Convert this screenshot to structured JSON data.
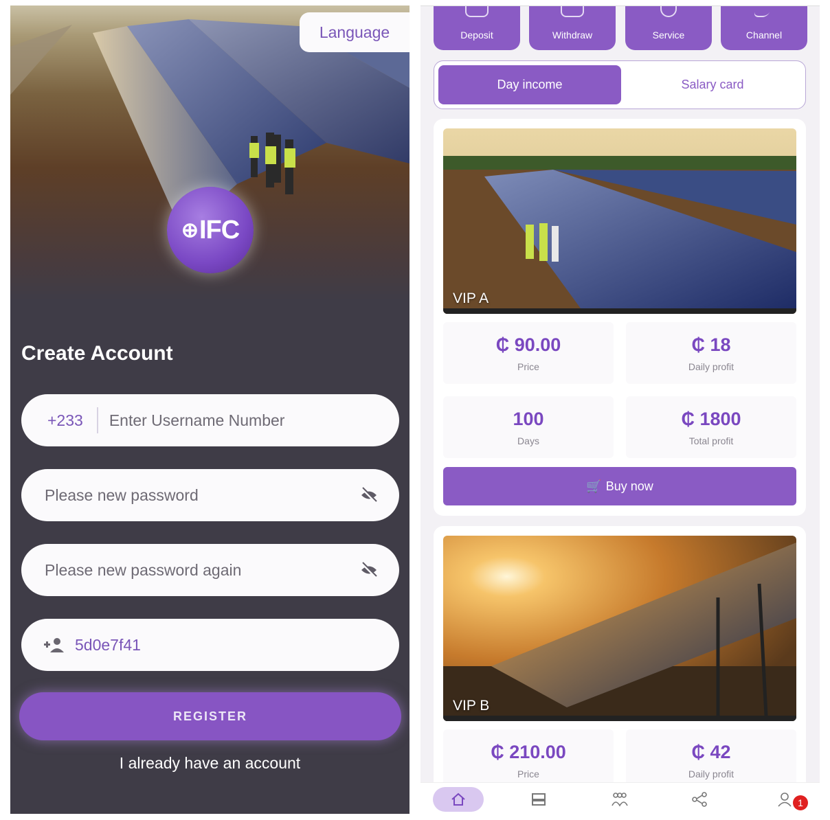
{
  "register": {
    "language_label": "Language",
    "logo_text": "IFC",
    "title": "Create Account",
    "country_code": "+233",
    "username_placeholder": "Enter Username Number",
    "password_placeholder": "Please new password",
    "password_again_placeholder": "Please new password again",
    "invite_code": "5d0e7f41",
    "register_button": "REGISTER",
    "login_link": "I already have an account",
    "colors": {
      "accent": "#8755c3",
      "background": "#3f3c47"
    }
  },
  "dashboard": {
    "quick_actions": [
      {
        "label": "Deposit",
        "icon": "deposit-icon"
      },
      {
        "label": "Withdraw",
        "icon": "withdraw-icon"
      },
      {
        "label": "Service",
        "icon": "service-icon"
      },
      {
        "label": "Channel",
        "icon": "channel-icon"
      }
    ],
    "tabs": [
      {
        "label": "Day income",
        "active": true
      },
      {
        "label": "Salary card",
        "active": false
      }
    ],
    "products": [
      {
        "name": "VIP A",
        "price": "₵ 90.00",
        "price_label": "Price",
        "daily_profit": "₵ 18",
        "daily_profit_label": "Daily profit",
        "days": "100",
        "days_label": "Days",
        "total_profit": "₵ 1800",
        "total_profit_label": "Total profit",
        "buy_label": "Buy now"
      },
      {
        "name": "VIP B",
        "price": "₵ 210.00",
        "price_label": "Price",
        "daily_profit": "₵ 42",
        "daily_profit_label": "Daily profit"
      }
    ],
    "bottom_nav": [
      {
        "icon": "home-icon",
        "active": true
      },
      {
        "icon": "products-icon",
        "active": false
      },
      {
        "icon": "team-icon",
        "active": false
      },
      {
        "icon": "share-icon",
        "active": false
      },
      {
        "icon": "profile-icon",
        "active": false,
        "badge": "1"
      }
    ],
    "colors": {
      "accent": "#8a5bc4",
      "notification": "#e02020"
    }
  }
}
